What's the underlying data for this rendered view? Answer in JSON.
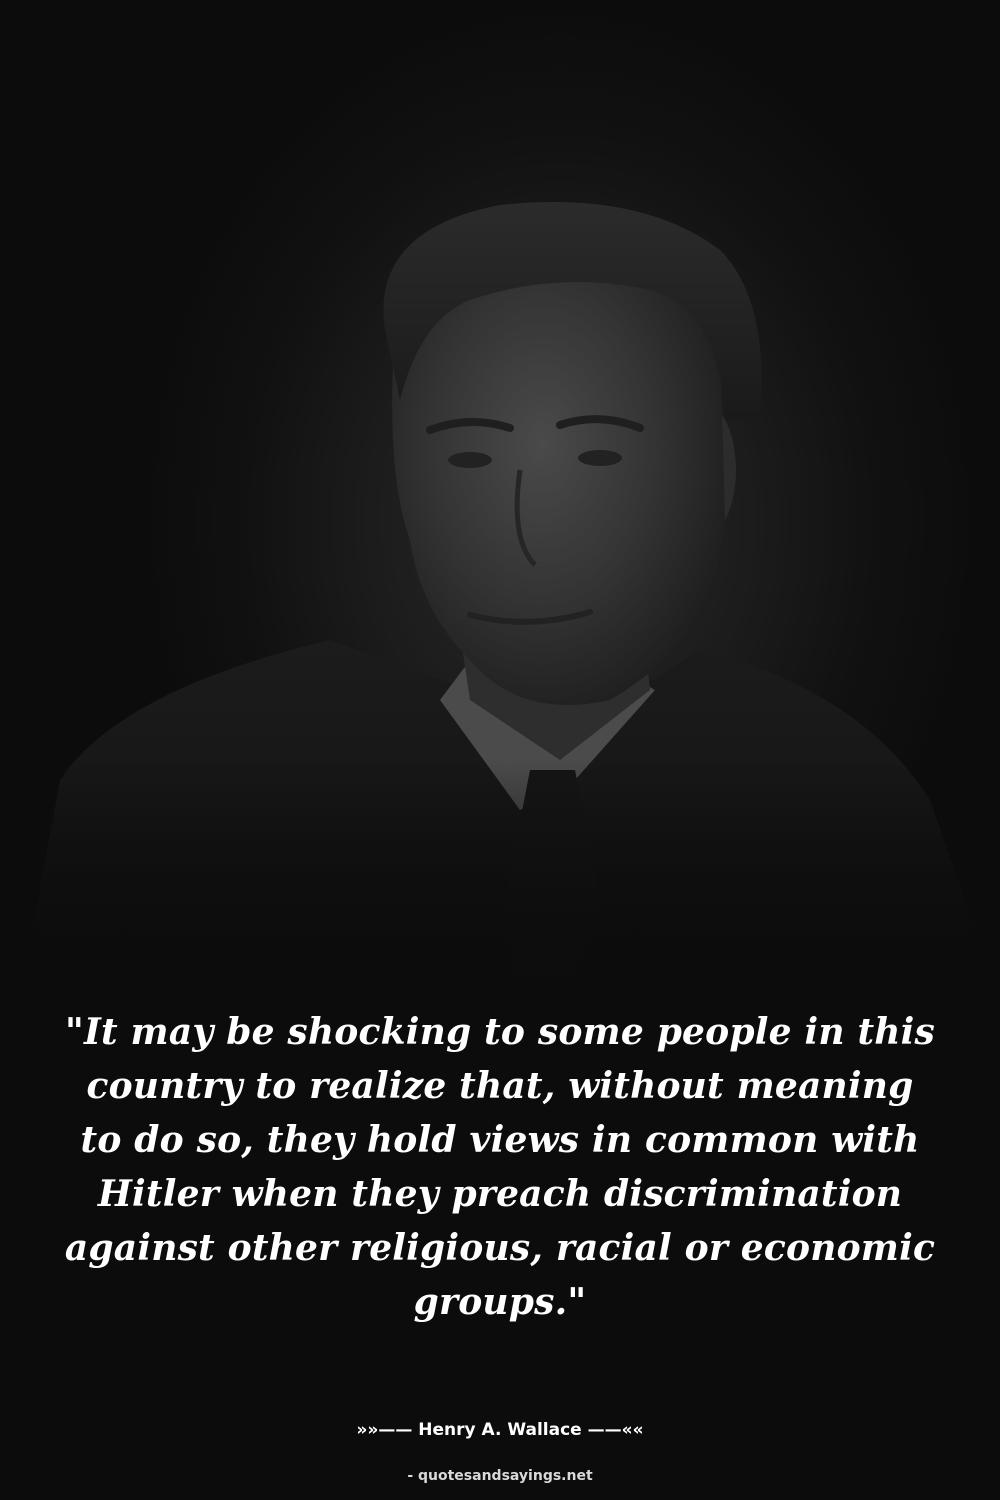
{
  "quote": {
    "text": "\"It may be shocking to some people in this country to realize that, without meaning to do so, they hold views in common with Hitler when they preach discrimination against other religious, racial or economic groups.\""
  },
  "author": {
    "line": "»»—— Henry A. Wallace ——««"
  },
  "source": {
    "text": "- quotesandsayings.net"
  },
  "colors": {
    "background": "#0c0c0c",
    "text": "#ffffff",
    "source_text": "#d9d9d9"
  }
}
